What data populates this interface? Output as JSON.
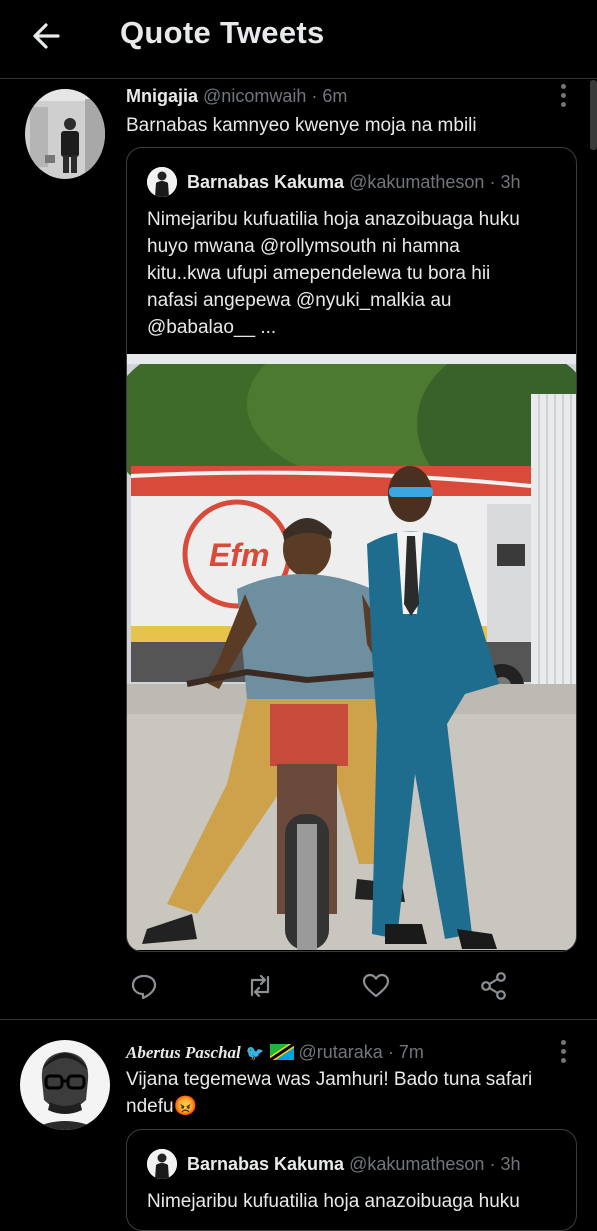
{
  "header": {
    "title": "Quote Tweets",
    "back_icon": "arrow-left-icon"
  },
  "tweets": [
    {
      "name": "Mnigajia",
      "handle": "@nicomwaih",
      "time": "· 6m",
      "text": "Barnabas kamnyeo kwenye moja na mbili",
      "quoted": {
        "name": "Barnabas Kakuma",
        "handle": "@kakumatheson",
        "time": "· 3h",
        "text_lines": [
          "Nimejaribu kufuatilia hoja anazoibuaga huku",
          "huyo mwana @rollymsouth ni hamna",
          "kitu..kwa ufupi amependelewa tu bora hii",
          "nafasi angepewa @nyuki_malkia au",
          "@babalao__ ..."
        ],
        "photo_sign": "Efm"
      }
    },
    {
      "name": "Abertus Paschal",
      "handle": "@rutaraka",
      "time": "· 7m",
      "text_lines": [
        "Vijana tegemewa was Jamhuri! Bado tuna safari",
        "ndefu😡"
      ],
      "quoted": {
        "name": "Barnabas Kakuma",
        "handle": "@kakumatheson",
        "time": "· 3h",
        "text_partial": "Nimejaribu kufuatilia hoja anazoibuaga huku"
      }
    }
  ],
  "colors": {
    "background": "#000000",
    "text": "#e7e9ea",
    "secondary": "#71767b",
    "border": "#2f3336"
  }
}
